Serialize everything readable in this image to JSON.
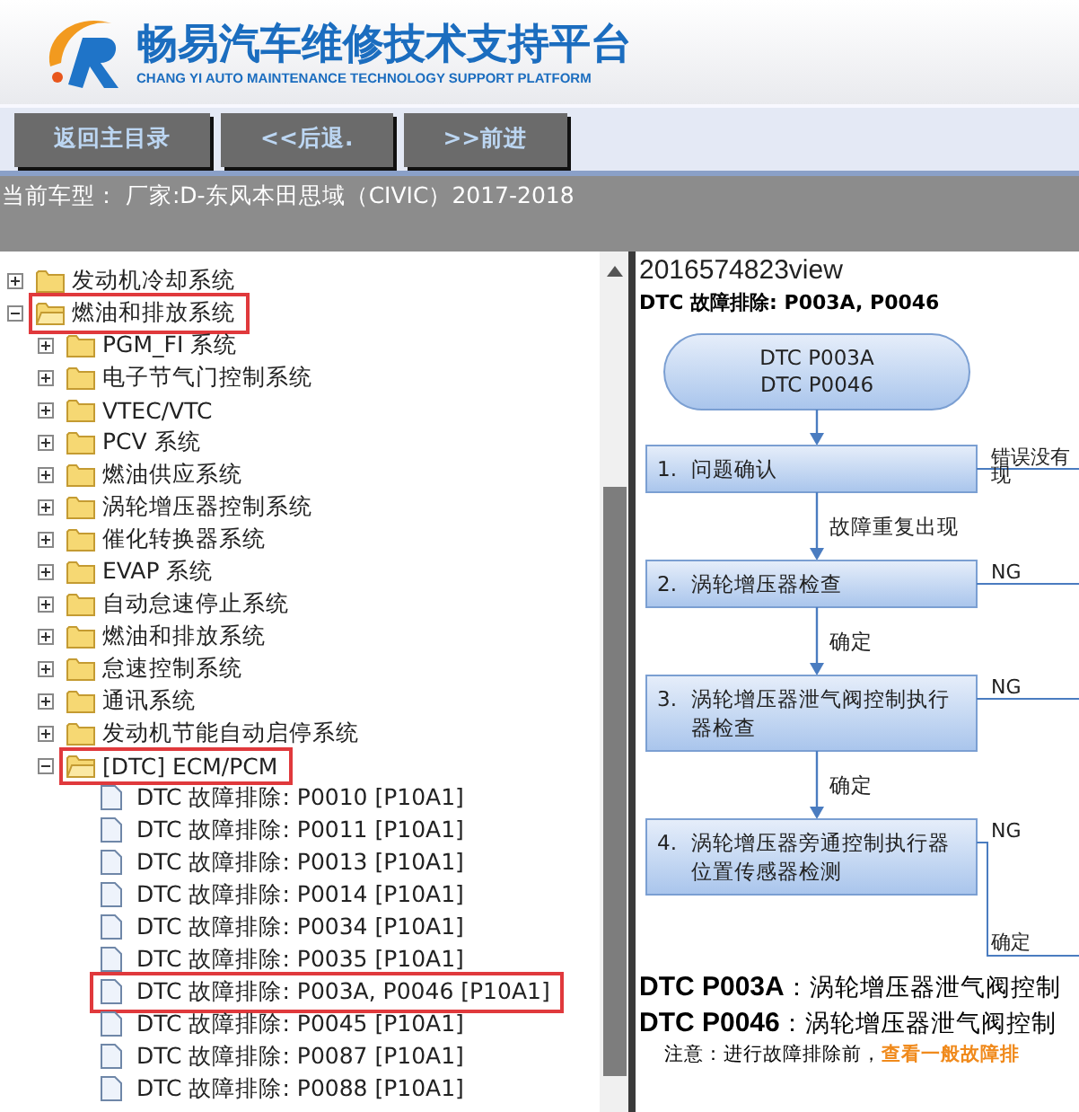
{
  "header": {
    "title": "畅易汽车维修技术支持平台",
    "subtitle": "CHANG YI AUTO MAINTENANCE TECHNOLOGY SUPPORT PLATFORM"
  },
  "toolbar": {
    "buttons": [
      "返回主目录",
      "<<后退.",
      ">>前进"
    ]
  },
  "current_model": "当前车型：  厂家:D-东风本田思域（CIVIC）2017-2018",
  "tree": [
    {
      "kind": "folder",
      "label": "发动机冷却系统",
      "expanded": false,
      "highlighted": false
    },
    {
      "kind": "folder",
      "label": "燃油和排放系统",
      "expanded": true,
      "highlighted": true,
      "children": [
        {
          "kind": "folder",
          "label": "PGM_FI 系统",
          "expanded": false,
          "highlighted": false
        },
        {
          "kind": "folder",
          "label": "电子节气门控制系统",
          "expanded": false,
          "highlighted": false
        },
        {
          "kind": "folder",
          "label": "VTEC/VTC",
          "expanded": false,
          "highlighted": false
        },
        {
          "kind": "folder",
          "label": "PCV 系统",
          "expanded": false,
          "highlighted": false
        },
        {
          "kind": "folder",
          "label": "燃油供应系统",
          "expanded": false,
          "highlighted": false
        },
        {
          "kind": "folder",
          "label": "涡轮增压器控制系统",
          "expanded": false,
          "highlighted": false
        },
        {
          "kind": "folder",
          "label": "催化转换器系统",
          "expanded": false,
          "highlighted": false
        },
        {
          "kind": "folder",
          "label": "EVAP 系统",
          "expanded": false,
          "highlighted": false
        },
        {
          "kind": "folder",
          "label": "自动怠速停止系统",
          "expanded": false,
          "highlighted": false
        },
        {
          "kind": "folder",
          "label": "燃油和排放系统",
          "expanded": false,
          "highlighted": false
        },
        {
          "kind": "folder",
          "label": "怠速控制系统",
          "expanded": false,
          "highlighted": false
        },
        {
          "kind": "folder",
          "label": "通讯系统",
          "expanded": false,
          "highlighted": false
        },
        {
          "kind": "folder",
          "label": "发动机节能自动启停系统",
          "expanded": false,
          "highlighted": false
        },
        {
          "kind": "folder",
          "label": "[DTC] ECM/PCM",
          "expanded": true,
          "highlighted": true,
          "children": [
            {
              "kind": "document",
              "label": "DTC 故障排除: P0010 [P10A1]",
              "highlighted": false
            },
            {
              "kind": "document",
              "label": "DTC 故障排除: P0011 [P10A1]",
              "highlighted": false
            },
            {
              "kind": "document",
              "label": "DTC 故障排除: P0013 [P10A1]",
              "highlighted": false
            },
            {
              "kind": "document",
              "label": "DTC 故障排除: P0014 [P10A1]",
              "highlighted": false
            },
            {
              "kind": "document",
              "label": "DTC 故障排除: P0034 [P10A1]",
              "highlighted": false
            },
            {
              "kind": "document",
              "label": "DTC 故障排除: P0035 [P10A1]",
              "highlighted": false
            },
            {
              "kind": "document",
              "label": "DTC 故障排除: P003A, P0046 [P10A1]",
              "highlighted": true
            },
            {
              "kind": "document",
              "label": "DTC 故障排除: P0045 [P10A1]",
              "highlighted": false
            },
            {
              "kind": "document",
              "label": "DTC 故障排除: P0087 [P10A1]",
              "highlighted": false
            },
            {
              "kind": "document",
              "label": "DTC 故障排除: P0088 [P10A1]",
              "highlighted": false
            }
          ]
        }
      ]
    }
  ],
  "content": {
    "doc_id": "2016574823view",
    "heading": "DTC 故障排除: P003A, P0046",
    "flowchart": {
      "start": [
        "DTC P003A",
        "DTC P0046"
      ],
      "steps": [
        {
          "number": "1.",
          "lines": [
            "问题确认"
          ],
          "side_label": [
            "错误没有",
            "现"
          ]
        },
        {
          "number": "2.",
          "lines": [
            "涡轮增压器检查"
          ],
          "side_label": [
            "NG"
          ],
          "above_label": "故障重复出现"
        },
        {
          "number": "3.",
          "lines": [
            "涡轮增压器泄气阀控制执行",
            "器检查"
          ],
          "side_label": [
            "NG"
          ],
          "above_label": "确定"
        },
        {
          "number": "4.",
          "lines": [
            "涡轮增压器旁通控制执行器",
            "位置传感器检测"
          ],
          "side_label": [
            "NG"
          ],
          "above_label": "确定"
        }
      ],
      "end_label": "确定"
    },
    "descriptions": [
      "**DTC P003A**：涡轮增压器泄气阀控制",
      "**DTC P0046**：涡轮增压器泄气阀控制"
    ],
    "note": {
      "text": "注意：进行故障排除前，",
      "link": "查看一般故障排"
    }
  }
}
